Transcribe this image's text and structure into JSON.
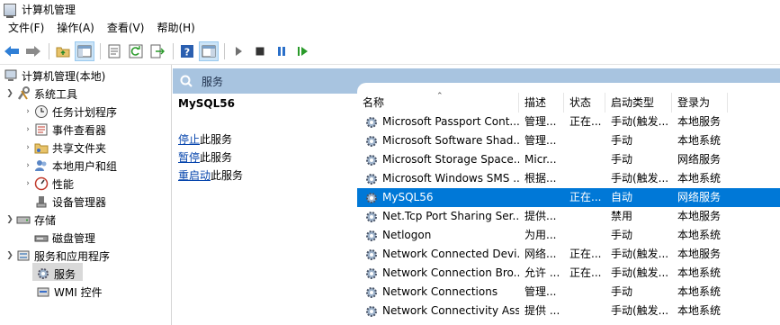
{
  "window": {
    "title": "计算机管理"
  },
  "menu": [
    "文件(F)",
    "操作(A)",
    "查看(V)",
    "帮助(H)"
  ],
  "toolbar": {
    "buttons": [
      "back-arrow-icon",
      "forward-arrow-icon",
      "folder-up-icon",
      "console-tree-icon",
      "properties-icon",
      "refresh-icon",
      "export-icon",
      "help-icon",
      "action-pane-icon",
      "play-icon",
      "stop-icon",
      "pause-icon",
      "restart-icon"
    ]
  },
  "tree": {
    "root": "计算机管理(本地)",
    "items": [
      {
        "label": "系统工具"
      },
      {
        "label": "任务计划程序"
      },
      {
        "label": "事件查看器"
      },
      {
        "label": "共享文件夹"
      },
      {
        "label": "本地用户和组"
      },
      {
        "label": "性能"
      },
      {
        "label": "设备管理器"
      },
      {
        "label": "存储"
      },
      {
        "label": "磁盘管理"
      },
      {
        "label": "服务和应用程序"
      },
      {
        "label": "服务"
      },
      {
        "label": "WMI 控件"
      }
    ]
  },
  "pane": {
    "title": "服务"
  },
  "detail": {
    "service_name": "MySQL56",
    "links": [
      {
        "link": "停止",
        "rest": "此服务"
      },
      {
        "link": "暂停",
        "rest": "此服务"
      },
      {
        "link": "重启动",
        "rest": "此服务"
      }
    ]
  },
  "columns": [
    "名称",
    "描述",
    "状态",
    "启动类型",
    "登录为"
  ],
  "rows": [
    [
      "Microsoft Passport Cont...",
      "管理...",
      "正在...",
      "手动(触发...",
      "本地服务"
    ],
    [
      "Microsoft Software Shad...",
      "管理...",
      "",
      "手动",
      "本地系统"
    ],
    [
      "Microsoft Storage Space...",
      "Micr...",
      "",
      "手动",
      "网络服务"
    ],
    [
      "Microsoft Windows SMS ...",
      "根据...",
      "",
      "手动(触发...",
      "本地系统"
    ],
    [
      "MySQL56",
      "",
      "正在...",
      "自动",
      "网络服务"
    ],
    [
      "Net.Tcp Port Sharing Ser...",
      "提供...",
      "",
      "禁用",
      "本地服务"
    ],
    [
      "Netlogon",
      "为用...",
      "",
      "手动",
      "本地系统"
    ],
    [
      "Network Connected Devi...",
      "网络...",
      "正在...",
      "手动(触发...",
      "本地服务"
    ],
    [
      "Network Connection Bro...",
      "允许 ...",
      "正在...",
      "手动(触发...",
      "本地系统"
    ],
    [
      "Network Connections",
      "管理...",
      "",
      "手动",
      "本地系统"
    ],
    [
      "Network Connectivity Ass...",
      "提供 ...",
      "",
      "手动(触发...",
      "本地系统"
    ]
  ],
  "selected_row": 4,
  "colors": {
    "header": "#a8c4e0",
    "selection": "#0078d7",
    "link": "#0645ad"
  }
}
